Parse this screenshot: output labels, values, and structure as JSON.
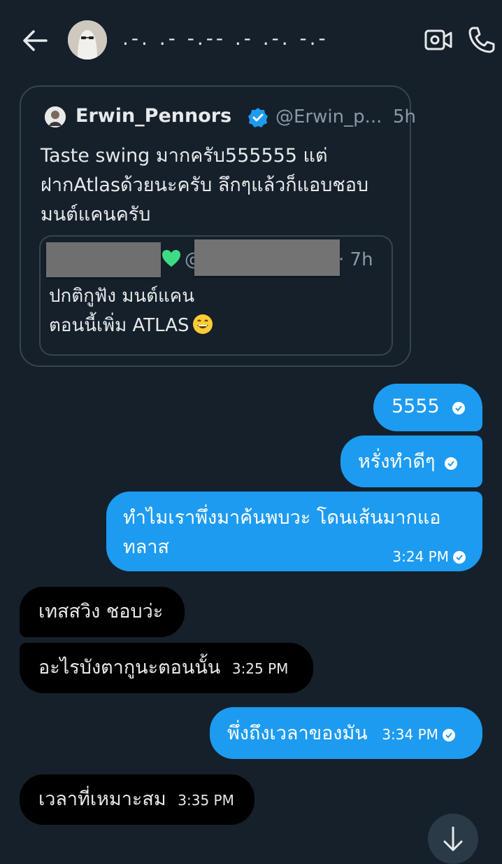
{
  "header": {
    "chat_name": ".-. .- -.-- .- .-. -.-",
    "back_icon": "arrow-left-icon",
    "video_icon": "video-camera-icon",
    "call_icon": "phone-icon"
  },
  "tweet": {
    "author": "Erwin_Pennors",
    "handle": "@Erwin_p...",
    "time": "5h",
    "text": "Taste swing มากครับ555555 แต่\nฝากAtlasด้วยนะครับ ลึกๆแล้วก็แอบชอบ\nมนต์แคนครับ",
    "quote": {
      "at": "@",
      "time": "· 7h",
      "text": "ปกติกูฟัง มนต์แคน\nตอนนี้เพิ่ม ATLAS"
    }
  },
  "messages": [
    {
      "side": "sent",
      "text": "5555",
      "time": ""
    },
    {
      "side": "sent",
      "text": "หรั่งทำดีๆ",
      "time": ""
    },
    {
      "side": "sent",
      "text": "ทำไมเราพึ่งมาค้นพบวะ โดนเส้นมากแอทลาส",
      "time": "3:24 PM"
    },
    {
      "side": "received",
      "text": "เทสสวิง ชอบว่ะ",
      "time": ""
    },
    {
      "side": "received",
      "text": "อะไรบังตากูนะตอนนั้น",
      "time": "3:25 PM"
    },
    {
      "side": "sent",
      "text": "พึ่งถึงเวลาของมัน",
      "time": "3:34 PM"
    },
    {
      "side": "received",
      "text": "เวลาที่เหมาะสม",
      "time": "3:35 PM"
    }
  ],
  "colors": {
    "background": "#15202b",
    "sent_bubble": "#1d9bf0",
    "received_bubble": "#000000",
    "accent": "#1d9bf0"
  }
}
